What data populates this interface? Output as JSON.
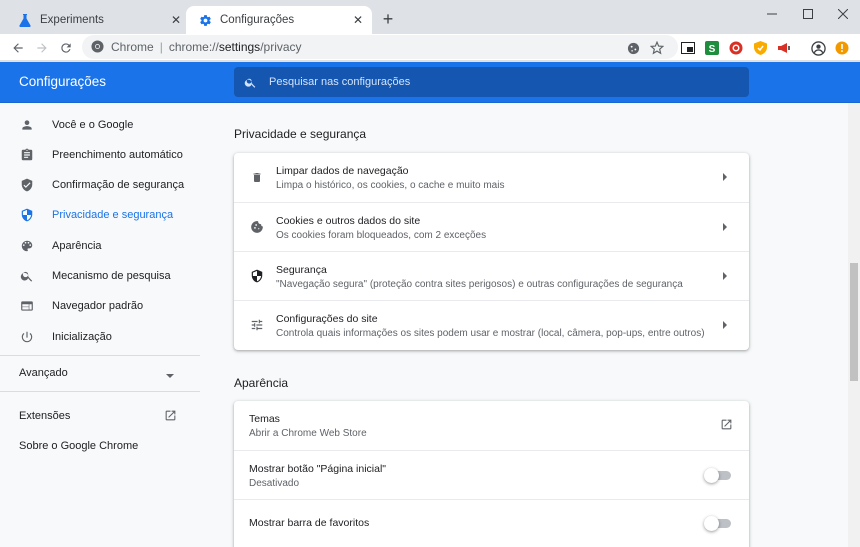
{
  "tabs": [
    {
      "title": "Experiments",
      "icon": "flask-icon"
    },
    {
      "title": "Configurações",
      "icon": "gear-icon"
    }
  ],
  "toolbar": {
    "origin": "Chrome",
    "url_prefix": "chrome://",
    "url_host": "settings",
    "url_path": "/privacy"
  },
  "header": {
    "title": "Configurações",
    "search_placeholder": "Pesquisar nas configurações"
  },
  "sidebar": {
    "items": [
      {
        "label": "Você e o Google",
        "icon": "person-icon"
      },
      {
        "label": "Preenchimento automático",
        "icon": "clipboard-icon"
      },
      {
        "label": "Confirmação de segurança",
        "icon": "shield-check-icon"
      },
      {
        "label": "Privacidade e segurança",
        "icon": "shield-icon",
        "selected": true
      },
      {
        "label": "Aparência",
        "icon": "palette-icon"
      },
      {
        "label": "Mecanismo de pesquisa",
        "icon": "search-icon"
      },
      {
        "label": "Navegador padrão",
        "icon": "browser-icon"
      },
      {
        "label": "Inicialização",
        "icon": "power-icon"
      }
    ],
    "advanced": "Avançado",
    "extensions": "Extensões",
    "about": "Sobre o Google Chrome"
  },
  "privacy": {
    "title": "Privacidade e segurança",
    "rows": [
      {
        "title": "Limpar dados de navegação",
        "subtitle": "Limpa o histórico, os cookies, o cache e muito mais",
        "icon": "trash-icon"
      },
      {
        "title": "Cookies e outros dados do site",
        "subtitle": "Os cookies foram bloqueados, com 2 exceções",
        "icon": "cookie-icon"
      },
      {
        "title": "Segurança",
        "subtitle": "\"Navegação segura\" (proteção contra sites perigosos) e outras configurações de segurança",
        "icon": "shield-icon"
      },
      {
        "title": "Configurações do site",
        "subtitle": "Controla quais informações os sites podem usar e mostrar (local, câmera, pop-ups, entre outros)",
        "icon": "tune-icon"
      }
    ]
  },
  "appearance": {
    "title": "Aparência",
    "rows": [
      {
        "title": "Temas",
        "subtitle": "Abrir a Chrome Web Store"
      },
      {
        "title": "Mostrar botão \"Página inicial\"",
        "subtitle": "Desativado",
        "toggle": false
      },
      {
        "title": "Mostrar barra de favoritos",
        "toggle": false
      }
    ]
  },
  "colors": {
    "accent": "#1a73e8",
    "header_bg": "#1a73e8",
    "search_bg": "#1557b0"
  }
}
